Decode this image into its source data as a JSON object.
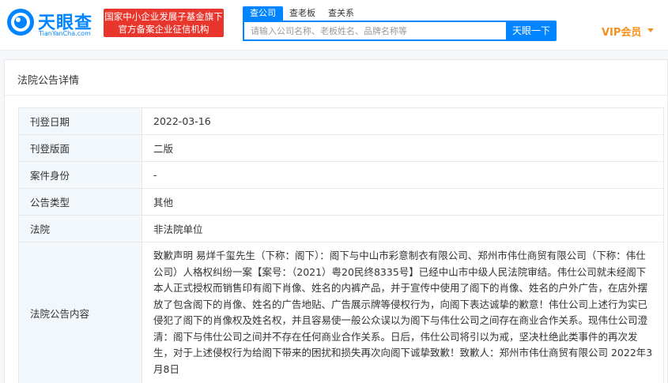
{
  "brand": {
    "name_cn": "天眼查",
    "name_en": "TianYanCha.com",
    "badge_line1": "国家中小企业发展子基金旗下",
    "badge_line2": "官方备案企业征信机构"
  },
  "search": {
    "tabs": [
      {
        "label": "查公司",
        "active": true
      },
      {
        "label": "查老板",
        "active": false
      },
      {
        "label": "查关系",
        "active": false
      }
    ],
    "placeholder": "请输入公司名称、老板姓名、品牌名称等",
    "button_label": "天眼一下"
  },
  "vip": {
    "label": "VIP会员"
  },
  "colors": {
    "brand_blue": "#0084ff",
    "badge_red": "#e8362c",
    "vip_orange": "#f58f1c",
    "label_bg": "#f2f7fc"
  },
  "page": {
    "title": "法院公告详情",
    "rows": [
      {
        "label": "刊登日期",
        "value": "2022-03-16"
      },
      {
        "label": "刊登版面",
        "value": "二版"
      },
      {
        "label": "案件身份",
        "value": "-"
      },
      {
        "label": "公告类型",
        "value": "其他"
      },
      {
        "label": "法院",
        "value": "非法院单位"
      },
      {
        "label": "法院公告内容",
        "value": "致歉声明 易烊千玺先生（下称：阁下）：阁下与中山市彩意制衣有限公司、郑州市伟仕商贸有限公司（下称：伟仕公司）人格权纠纷一案【案号：（2021）粤20民终8335号】已经中山市中级人民法院审结。伟仕公司就未经阁下本人正式授权而销售印有阁下肖像、姓名的内裤产品，并于宣传中使用了阁下的肖像、姓名的户外广告，在店外摆放了包含阁下的肖像、姓名的广告地贴、广告展示牌等侵权行为，向阁下表达诚挚的歉意！伟仕公司上述行为实已侵犯了阁下的肖像权及姓名权，并且容易使一般公众误以为阁下与伟仕公司之间存在商业合作关系。现伟仕公司澄清：阁下与伟仕公司之间并不存在任何商业合作关系。日后，伟仕公司将引以为戒，坚决杜绝此类事件的再次发生，对于上述侵权行为给阁下带来的困扰和损失再次向阁下诚挚致歉！致歉人：郑州市伟仕商贸有限公司 2022年3月8日"
      }
    ]
  }
}
